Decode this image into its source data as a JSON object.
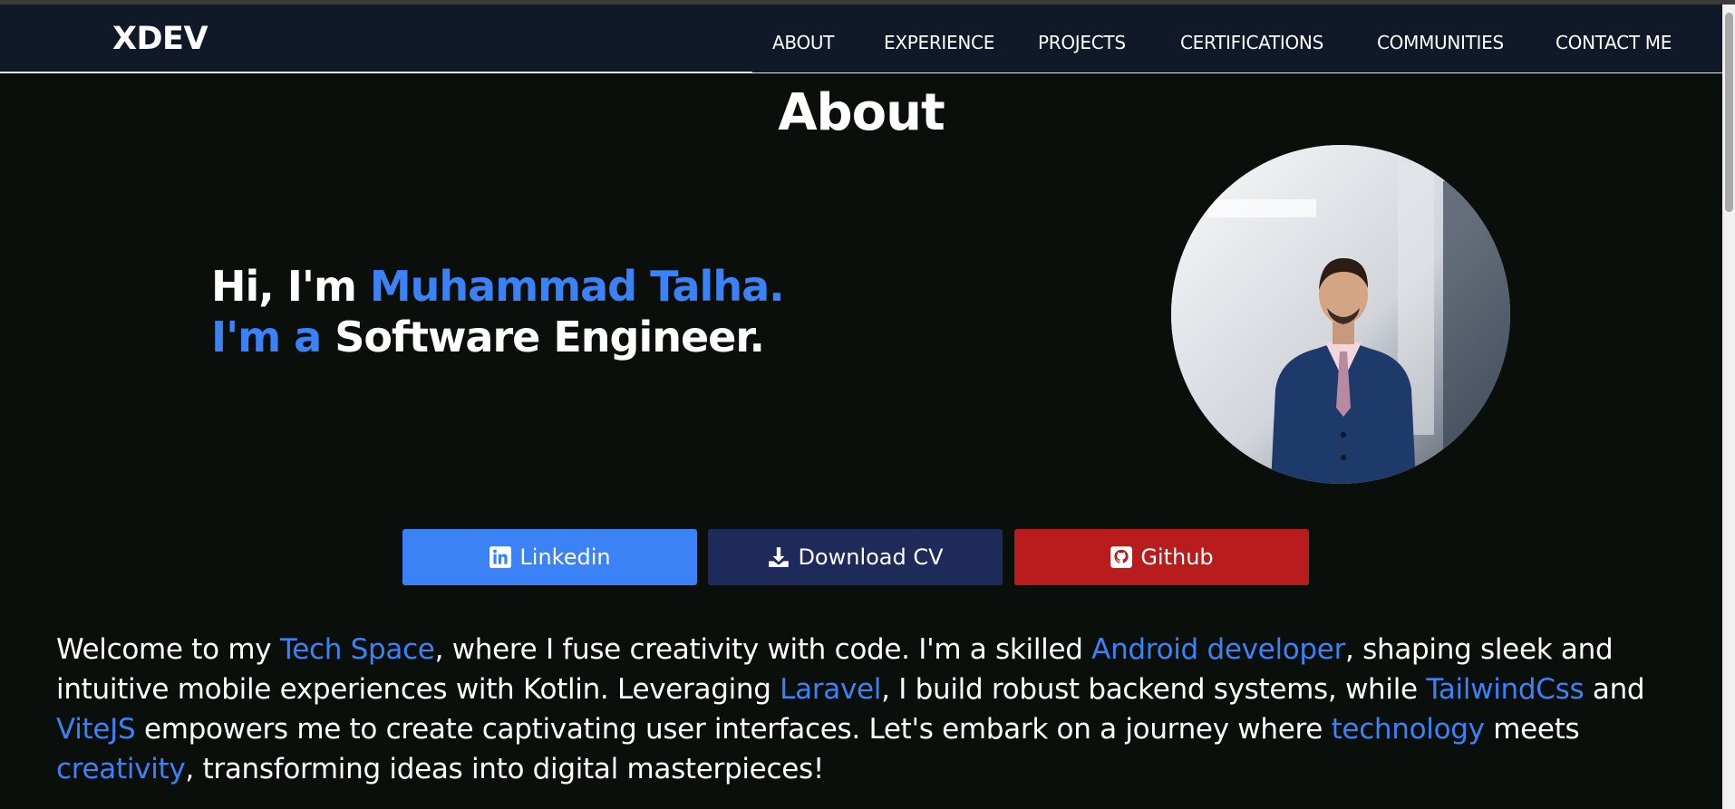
{
  "nav": {
    "brand": "XDEV",
    "links": [
      "ABOUT",
      "EXPERIENCE",
      "PROJECTS",
      "CERTIFICATIONS",
      "COMMUNITIES",
      "CONTACT ME"
    ]
  },
  "about": {
    "title": "About",
    "greeting": {
      "line1_prefix": "Hi, I'm ",
      "line1_name": "Muhammad Talha.",
      "line2_prefix": "I'm a ",
      "line2_role": "Software Engineer."
    },
    "photo_alt": "profile-photo"
  },
  "buttons": {
    "linkedin": "Linkedin",
    "download_cv": "Download CV",
    "github": "Github"
  },
  "intro": {
    "p1": "Welcome to my ",
    "h1": "Tech Space",
    "p2": ", where I fuse creativity with code. I'm a skilled ",
    "h2": "Android developer",
    "p3": ", shaping sleek and intuitive mobile experiences with Kotlin. Leveraging ",
    "h3": "Laravel",
    "p4": ", I build robust backend systems, while ",
    "h4": "TailwindCss",
    "p5": " and ",
    "h5": "ViteJS",
    "p6": " empowers me to create captivating user interfaces. Let's embark on a journey where ",
    "h6": "technology",
    "p7": " meets ",
    "h7": "creativity",
    "p8": ", transforming ideas into digital masterpieces!"
  },
  "colors": {
    "accent": "#3b82f6",
    "linkedin_btn": "#3b82f6",
    "download_btn": "#1e2a5a",
    "github_btn": "#b91c1c",
    "navbar_bg": "#111827",
    "page_bg": "#0b0f0c"
  },
  "icons": {
    "linkedin": "linkedin-icon",
    "download": "download-icon",
    "github": "github-icon"
  }
}
